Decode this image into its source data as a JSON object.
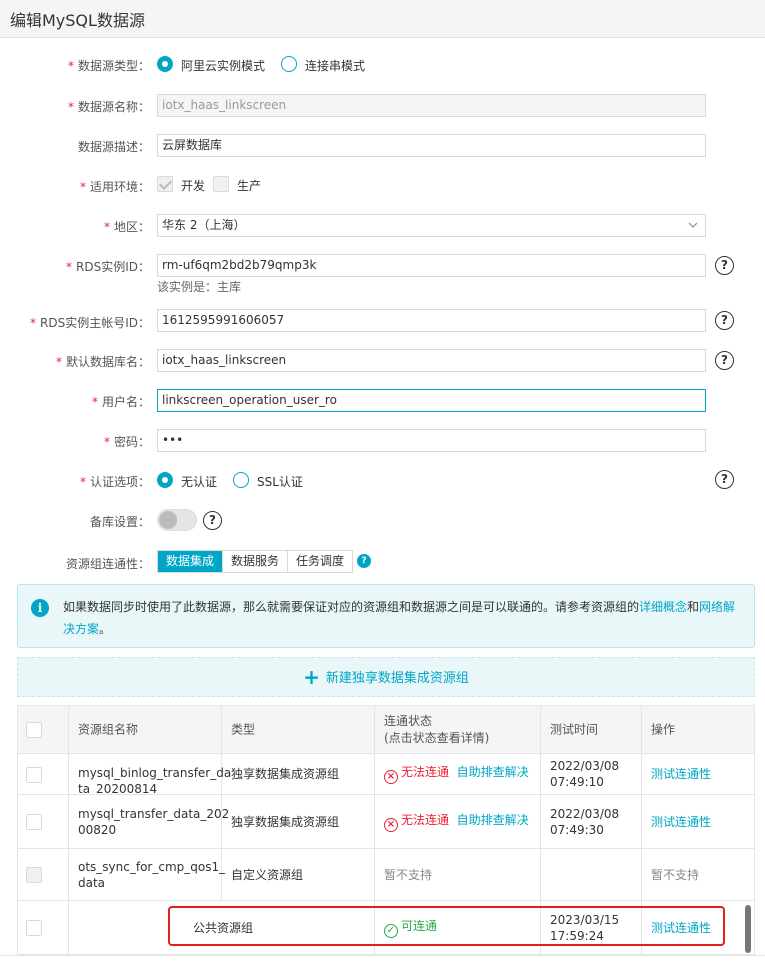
{
  "window": {
    "title": "编辑MySQL数据源"
  },
  "form": {
    "source_type": {
      "label": "数据源类型：",
      "options": [
        "阿里云实例模式",
        "连接串模式"
      ],
      "selected": "阿里云实例模式"
    },
    "source_name": {
      "label": "数据源名称：",
      "value": "iotx_haas_linkscreen"
    },
    "source_desc": {
      "label": "数据源描述：",
      "value": "云屏数据库"
    },
    "env": {
      "label": "适用环境：",
      "options": [
        "开发",
        "生产"
      ],
      "checked": [
        "开发"
      ]
    },
    "region": {
      "label": "地区：",
      "value": "华东 2（上海）"
    },
    "rds_instance": {
      "label": "RDS实例ID：",
      "value": "rm-uf6qm2bd2b79qmp3k",
      "hint": "该实例是：主库"
    },
    "rds_owner": {
      "label": "RDS实例主帐号ID：",
      "value": "1612595991606057"
    },
    "default_db": {
      "label": "默认数据库名：",
      "value": "iotx_haas_linkscreen"
    },
    "username": {
      "label": "用户名：",
      "value": "linkscreen_operation_user_ro"
    },
    "password": {
      "label": "密码：",
      "value": "•••"
    },
    "auth": {
      "label": "认证选项：",
      "options": [
        "无认证",
        "SSL认证"
      ],
      "selected": "无认证"
    },
    "standby": {
      "label": "备库设置：",
      "enabled": false
    },
    "connectivity": {
      "label": "资源组连通性：",
      "tabs": [
        "数据集成",
        "数据服务",
        "任务调度"
      ],
      "active": "数据集成"
    }
  },
  "notice": {
    "text_before": "如果数据同步时使用了此数据源，那么就需要保证对应的资源组和数据源之间是可以联通的。请参考资源组的",
    "link1": "详细概念",
    "and": "和",
    "link2": "网络解决方案",
    "text_after": "。"
  },
  "new_group_button": "新建独享数据集成资源组",
  "table": {
    "headers": {
      "name": "资源组名称",
      "type": "类型",
      "status_line1": "连通状态",
      "status_line2": "(点击状态查看详情)",
      "time": "测试时间",
      "action": "操作"
    },
    "rows": [
      {
        "name_line1": "mysql_binlog_transfer_da",
        "name_line2": "ta_20200814",
        "type": "独享数据集成资源组",
        "status": "无法连通",
        "status_kind": "error",
        "status_link": "自助排查解决",
        "time_line1": "2022/03/08",
        "time_line2": "07:49:10",
        "action": "测试连通性"
      },
      {
        "name_line1": "mysql_transfer_data_202",
        "name_line2": "00820",
        "type": "独享数据集成资源组",
        "status": "无法连通",
        "status_kind": "error",
        "status_link": "自助排查解决",
        "time_line1": "2022/03/08",
        "time_line2": "07:49:30",
        "action": "测试连通性"
      },
      {
        "name_line1": "ots_sync_for_cmp_qos1_",
        "name_line2": "data",
        "type": "自定义资源组",
        "status": "暂不支持",
        "status_kind": "none",
        "status_link": "",
        "time_line1": "",
        "time_line2": "",
        "action": "暂不支持"
      },
      {
        "name_line1": "",
        "name_line2": "",
        "type": "公共资源组",
        "status": "可连通",
        "status_kind": "ok",
        "status_link": "",
        "time_line1": "2023/03/15",
        "time_line2": "17:59:24",
        "action": "测试连通性"
      }
    ]
  }
}
